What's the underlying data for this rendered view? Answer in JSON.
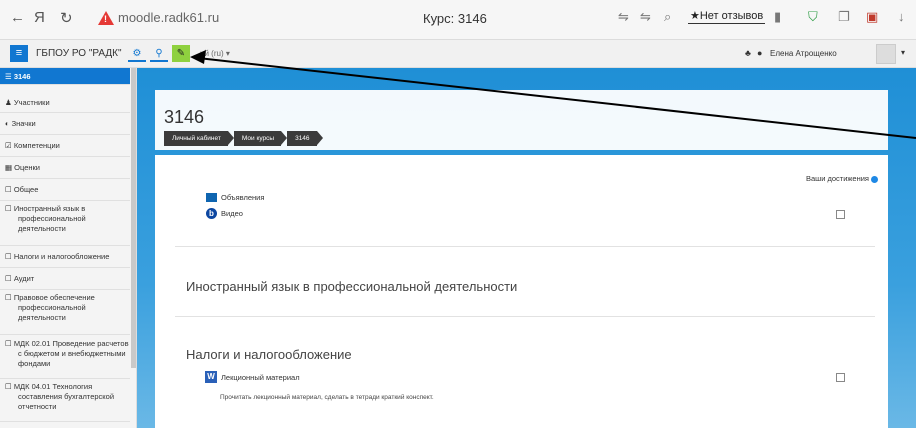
{
  "browser": {
    "back": "←",
    "yandex": "Я",
    "reload": "↻",
    "url": "moodle.radk61.ru",
    "tab_title": "Курс: 3146",
    "review": "★Нет отзывов"
  },
  "moodle_nav": {
    "menu": "≡",
    "site_name": "ГБПОУ РО \"РАДК\"",
    "language": "ий (ru) ▾",
    "user_name": "Елена Атрощенко"
  },
  "sidebar": {
    "items": [
      {
        "label": "3146"
      },
      {
        "label": "Участники"
      },
      {
        "label": "Значки"
      },
      {
        "label": "Компетенции"
      },
      {
        "label": "Оценки"
      },
      {
        "label": "Общее"
      },
      {
        "label": "Иностранный язык в профессиональной деятельности"
      },
      {
        "label": "Налоги и налогообложение"
      },
      {
        "label": "Аудит"
      },
      {
        "label": "Правовое обеспечение профессиональной деятельности"
      },
      {
        "label": "МДК 02.01 Проведение расчетов с бюджетом и внебюджетными фондами"
      },
      {
        "label": "МДК 04.01 Технология составления бухгалтерской отчетности"
      }
    ]
  },
  "main": {
    "course_title": "3146",
    "breadcrumbs": [
      "Личный кабинет",
      "Мои курсы",
      "3146"
    ],
    "achievements": "Ваши достижения",
    "activities": {
      "announcements": "Объявления",
      "video": "Видео",
      "lecture": "Лекционный материал"
    },
    "sections": {
      "foreign": "Иностранный язык в профессиональной деятельности",
      "taxes": "Налоги и налогообложение"
    },
    "lecture_desc": "Прочитать лекционный материал, сделать в тетради краткий конспект."
  },
  "colors": {
    "accent": "#1177d1",
    "edit_button": "#8fd13f",
    "main_bg": "#1f8fd6"
  }
}
